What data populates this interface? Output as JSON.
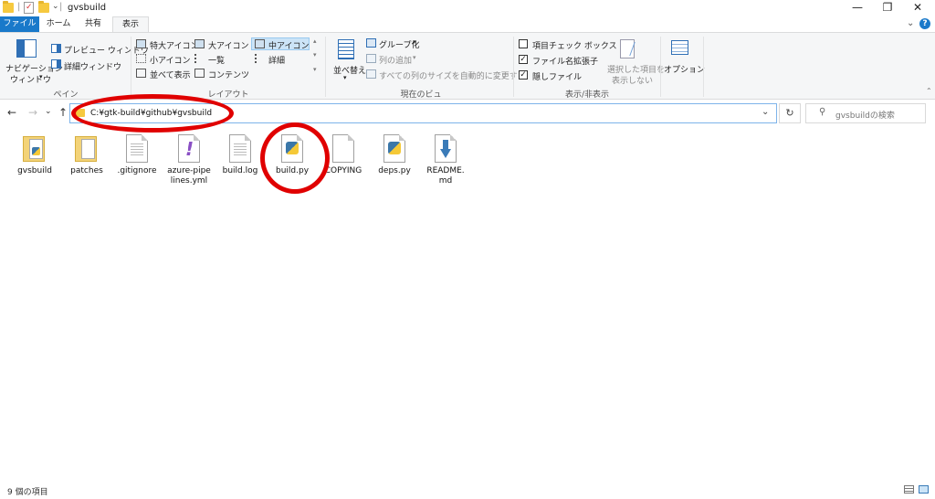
{
  "window": {
    "title": "gvsbuild",
    "controls": {
      "minimize": "—",
      "maximize": "❐",
      "close": "✕"
    }
  },
  "tabs": [
    {
      "label": "ファイル",
      "active": false,
      "accent": "#1979ca"
    },
    {
      "label": "ホーム",
      "active": false
    },
    {
      "label": "共有",
      "active": false
    },
    {
      "label": "表示",
      "active": true
    }
  ],
  "ribbon": {
    "pane": {
      "navigation_pane": "ナビゲーション",
      "navigation_pane_2": "ウィンドウ",
      "preview_pane": "プレビュー ウィンドウ",
      "details_pane": "詳細ウィンドウ",
      "group_label": "ペイン"
    },
    "layout": {
      "items": [
        "特大アイコン",
        "大アイコン",
        "中アイコン",
        "小アイコン",
        "一覧",
        "詳細",
        "並べて表示",
        "コンテンツ"
      ],
      "selected": "中アイコン",
      "group_label": "レイアウト"
    },
    "current_view": {
      "sort_by": "並べ替え",
      "group_by": "グループ化",
      "add_columns": "列の追加",
      "size_columns": "すべての列のサイズを自動的に変更する",
      "group_label": "現在のビュー"
    },
    "show_hide": {
      "item_check_boxes": "項目チェック ボックス",
      "file_name_extensions": "ファイル名拡張子",
      "hidden_items": "隠しファイル",
      "item_check_boxes_checked": false,
      "file_name_extensions_checked": true,
      "hidden_items_checked": true,
      "hide_selected_1": "選択した項目を",
      "hide_selected_2": "表示しない",
      "group_label": "表示/非表示"
    },
    "options": {
      "label": "オプション"
    }
  },
  "navigation": {
    "back": "←",
    "forward": "→",
    "recent": "⌄",
    "up": "↑",
    "address": "C:¥gtk-build¥github¥gvsbuild",
    "refresh": "↻",
    "dropdown": "⌄",
    "search_placeholder": "gvsbuildの検索"
  },
  "files": [
    {
      "name": "gvsbuild",
      "type": "folder"
    },
    {
      "name": "patches",
      "type": "folder"
    },
    {
      "name": ".gitignore",
      "type": "text"
    },
    {
      "name": "azure-pipelines.yml",
      "type": "yml"
    },
    {
      "name": "build.log",
      "type": "text"
    },
    {
      "name": "build.py",
      "type": "python"
    },
    {
      "name": "COPYING",
      "type": "text"
    },
    {
      "name": "deps.py",
      "type": "python"
    },
    {
      "name": "README.md",
      "type": "md"
    }
  ],
  "status": {
    "item_count": "9 個の項目"
  },
  "annotation_color": "#e00000"
}
